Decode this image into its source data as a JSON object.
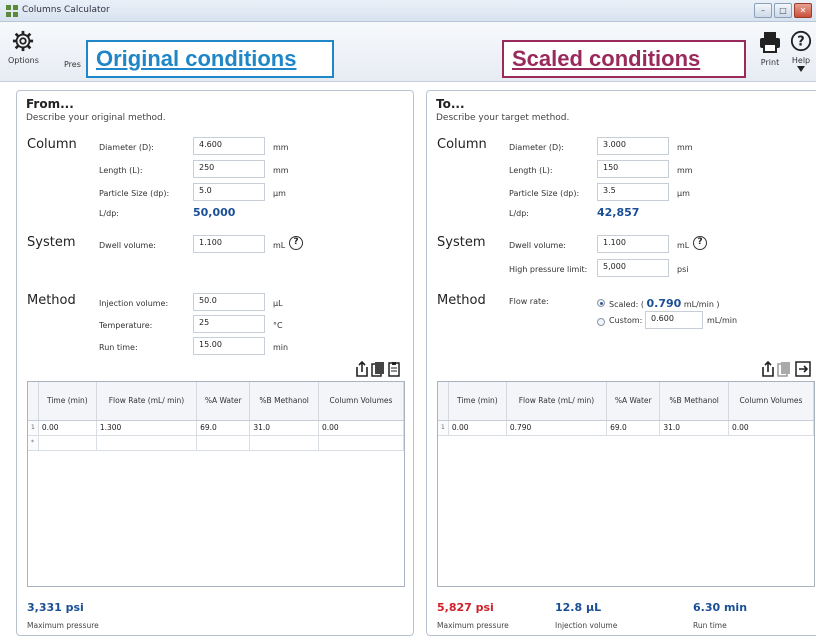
{
  "window": {
    "title": "Columns Calculator",
    "minimize": "–",
    "maximize": "□",
    "close": "✕"
  },
  "toolbar": {
    "options_label": "Options",
    "presets_label": "Pres",
    "print_label": "Print",
    "help_label": "Help"
  },
  "callouts": {
    "original": "Original conditions",
    "scaled": "Scaled conditions"
  },
  "from": {
    "title": "From...",
    "subtitle": "Describe your original method.",
    "column": {
      "heading": "Column",
      "diameter_label": "Diameter (D):",
      "diameter": "4.600",
      "diameter_unit": "mm",
      "length_label": "Length (L):",
      "length": "250",
      "length_unit": "mm",
      "particle_label": "Particle Size (dp):",
      "particle": "5.0",
      "particle_unit": "μm",
      "ldp_label": "L/dp:",
      "ldp": "50,000"
    },
    "system": {
      "heading": "System",
      "dwell_label": "Dwell volume:",
      "dwell": "1.100",
      "dwell_unit": "mL",
      "help": "?"
    },
    "method": {
      "heading": "Method",
      "inj_label": "Injection volume:",
      "inj": "50.0",
      "inj_unit": "μL",
      "temp_label": "Temperature:",
      "temp": "25",
      "temp_unit": "°C",
      "run_label": "Run time:",
      "run": "15.00",
      "run_unit": "min"
    },
    "grid": {
      "headers": [
        "Time (min)",
        "Flow Rate (mL/ min)",
        "%A Water",
        "%B Methanol",
        "Column Volumes"
      ],
      "row_marker": "1",
      "new_marker": "*",
      "rows": [
        [
          "0.00",
          "1.300",
          "69.0",
          "31.0",
          "0.00"
        ]
      ]
    },
    "bottom": {
      "pressure": "3,331 psi",
      "pressure_label": "Maximum pressure"
    }
  },
  "to": {
    "title": "To...",
    "subtitle": "Describe your target method.",
    "column": {
      "heading": "Column",
      "diameter_label": "Diameter (D):",
      "diameter": "3.000",
      "diameter_unit": "mm",
      "length_label": "Length (L):",
      "length": "150",
      "length_unit": "mm",
      "particle_label": "Particle Size (dp):",
      "particle": "3.5",
      "particle_unit": "μm",
      "ldp_label": "L/dp:",
      "ldp": "42,857"
    },
    "system": {
      "heading": "System",
      "dwell_label": "Dwell volume:",
      "dwell": "1.100",
      "dwell_unit": "mL",
      "help": "?",
      "hp_label": "High pressure limit:",
      "hp": "5,000",
      "hp_unit": "psi"
    },
    "method": {
      "heading": "Method",
      "flow_label": "Flow rate:",
      "scaled_prefix": "Scaled: (",
      "scaled_value": "0.790",
      "scaled_suffix": "mL/min )",
      "custom_label": "Custom:",
      "custom_value": "0.600",
      "custom_unit": "mL/min"
    },
    "grid": {
      "headers": [
        "Time (min)",
        "Flow Rate (mL/ min)",
        "%A Water",
        "%B Methanol",
        "Column Volumes"
      ],
      "row_marker": "1",
      "rows": [
        [
          "0.00",
          "0.790",
          "69.0",
          "31.0",
          "0.00"
        ]
      ]
    },
    "bottom": {
      "pressure": "5,827 psi",
      "pressure_label": "Maximum pressure",
      "injection": "12.8 μL",
      "injection_label": "Injection volume",
      "runtime": "6.30 min",
      "runtime_label": "Run time"
    }
  },
  "colors": {
    "accent_blue": "#1a4f96",
    "warn_red": "#d0202a",
    "callout_blue": "#1f86c8",
    "callout_maroon": "#9a2a5c"
  }
}
